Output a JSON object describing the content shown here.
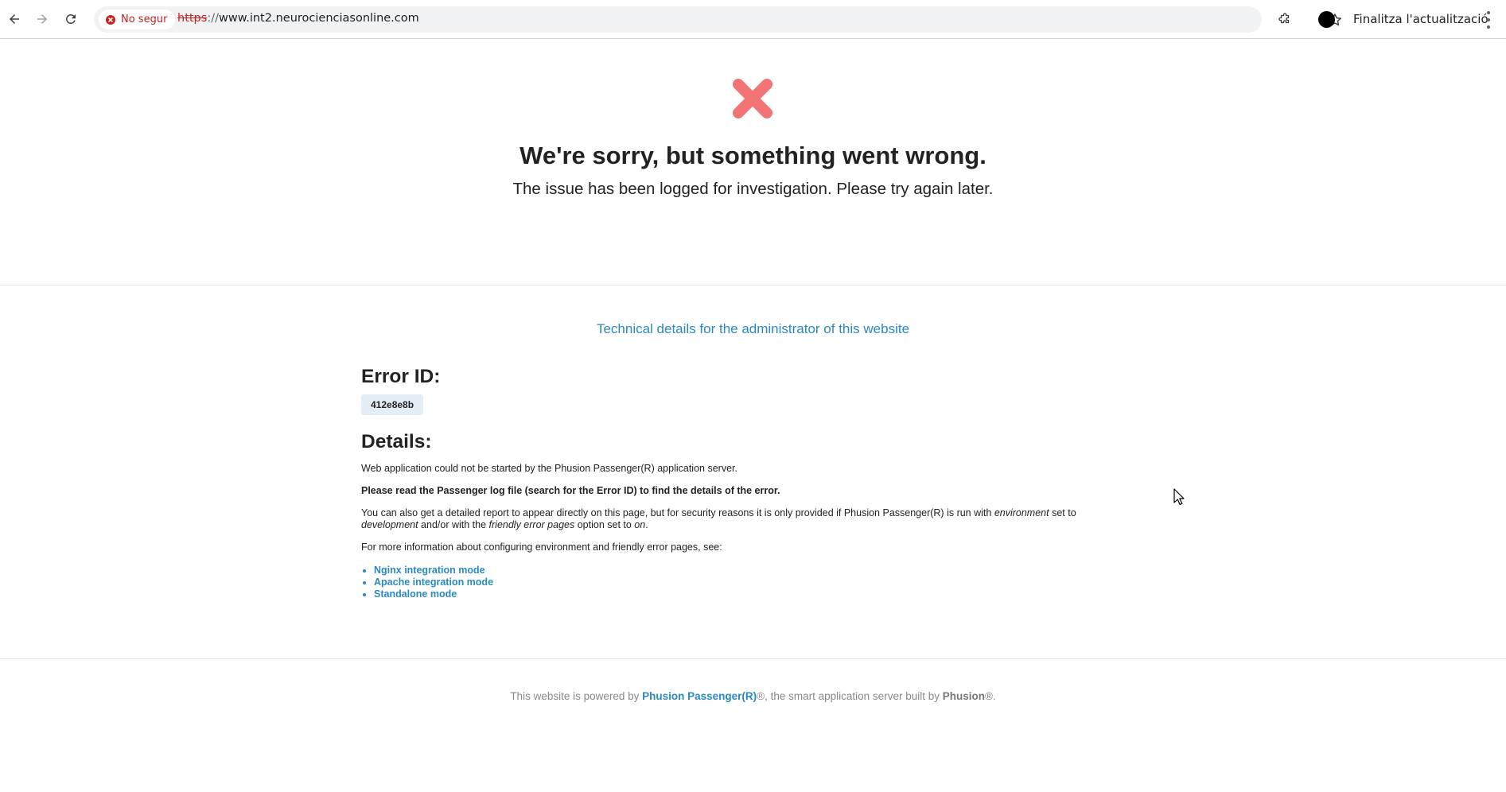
{
  "browser": {
    "security_chip_label": "No segur",
    "url_scheme": "https",
    "url_sep": "://",
    "url_host": "www.int2.neurocienciasonline.com",
    "update_label": "Finalitza l'actualització",
    "icons": [
      "back-icon",
      "forward-icon",
      "reload-icon",
      "warning-icon",
      "star-icon",
      "extensions-icon",
      "profile-avatar",
      "kebab-menu-icon"
    ]
  },
  "page": {
    "heading": "We're sorry, but something went wrong.",
    "subheading": "The issue has been logged for investigation. Please try again later.",
    "tech_link": "Technical details for the administrator of this website",
    "error_id_heading": "Error ID:",
    "error_id": "412e8e8b",
    "details_heading": "Details:",
    "p1": "Web application could not be started by the Phusion Passenger(R) application server.",
    "p2": "Please read the Passenger log file (search for the Error ID) to find the details of the error.",
    "p3_a": "You can also get a detailed report to appear directly on this page, but for security reasons it is only provided if Phusion Passenger(R) is run with ",
    "p3_em1": "environment",
    "p3_b": " set to ",
    "p3_em2": "development",
    "p3_c": " and/or with the ",
    "p3_em3": "friendly error pages",
    "p3_d": " option set to ",
    "p3_em4": "on",
    "p3_e": ".",
    "p4": "For more information about configuring environment and friendly error pages, see:",
    "links": [
      "Nginx integration mode",
      "Apache integration mode",
      "Standalone mode"
    ],
    "footer_a": "This website is powered by ",
    "footer_link": "Phusion Passenger(R)",
    "footer_b": "®, the smart application server built by ",
    "footer_brand": "Phusion",
    "footer_c": "®."
  },
  "colors": {
    "link": "#2a8ac0",
    "error_icon": "#f27474",
    "insecure": "#c5221f",
    "error_id_bg": "#e3edf6"
  }
}
